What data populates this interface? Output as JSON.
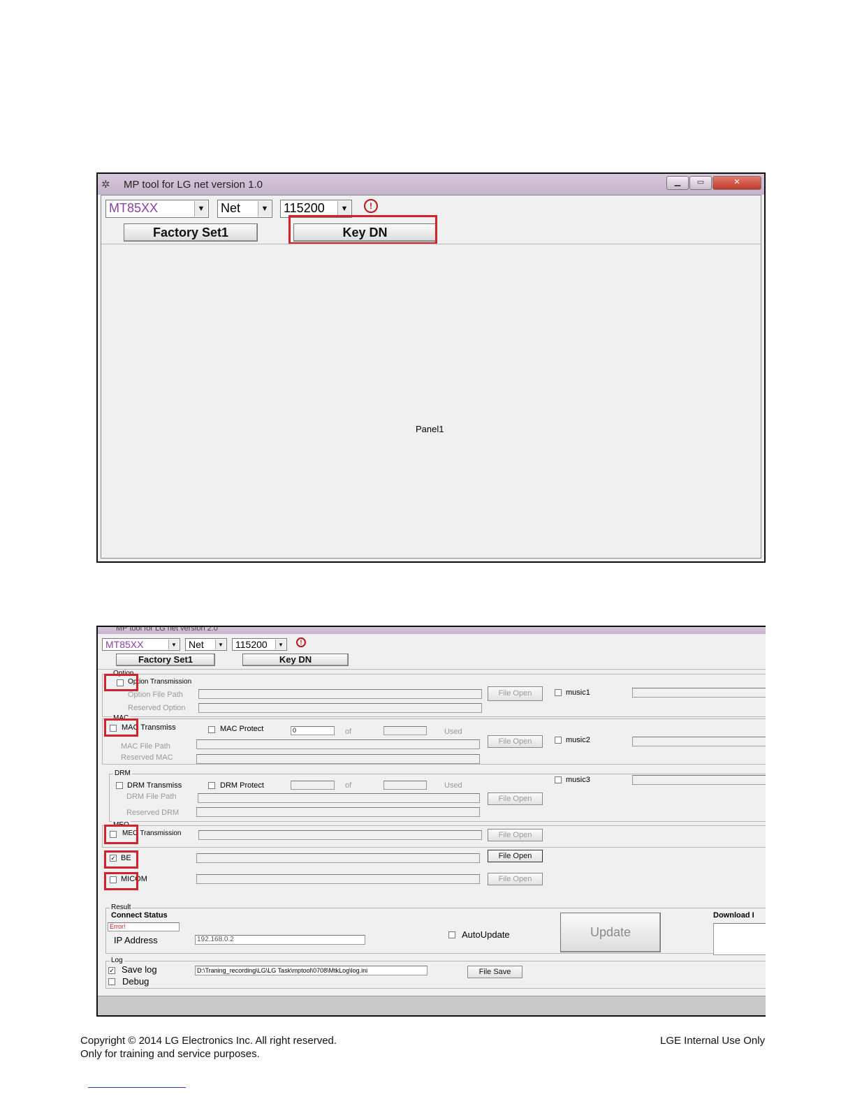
{
  "window1": {
    "title": "MP tool for LG net version 1.0",
    "chip_select": "MT85XX",
    "mode_select": "Net",
    "baud_select": "115200",
    "factory_set_label": "Factory Set1",
    "key_dn_label": "Key DN",
    "panel_label": "Panel1"
  },
  "window2": {
    "title": "MP tool for LG net version 2.0",
    "chip_select": "MT85XX",
    "mode_select": "Net",
    "baud_select": "115200",
    "factory_set_label": "Factory Set1",
    "key_dn_label": "Key DN",
    "option": {
      "group": "Option",
      "transmission_label": "Option Transmission",
      "file_path_label": "Option File Path",
      "reserved_label": "Reserved Option",
      "file_open": "File Open"
    },
    "mac": {
      "group": "MAC",
      "transmission_label": "MAC Transmiss",
      "protect_label": "MAC Protect",
      "count_value": "0",
      "of_label": "of",
      "used_label": "Used",
      "file_path_label": "MAC File Path",
      "reserved_label": "Reserved MAC",
      "file_open": "File Open"
    },
    "drm": {
      "group": "DRM",
      "transmission_label": "DRM Transmiss",
      "protect_label": "DRM Protect",
      "of_label": "of",
      "used_label": "Used",
      "file_path_label": "DRM File Path",
      "reserved_label": "Reserved DRM",
      "file_open": "File Open"
    },
    "music": [
      "music1",
      "music2",
      "music3"
    ],
    "meo": {
      "group": "MEO",
      "transmission_label": "MEO Transmission",
      "file_open": "File Open"
    },
    "be": {
      "label": "BE",
      "checked": true,
      "file_open": "File Open"
    },
    "micom": {
      "label": "MICOM",
      "file_open": "File Open"
    },
    "result": {
      "group": "Result",
      "connect_status_label": "Connect Status",
      "status_value": "Error!",
      "ip_label": "IP Address",
      "ip_value": "192.168.0.2",
      "auto_update_label": "AutoUpdate",
      "update_button": "Update",
      "download_label": "Download I"
    },
    "log": {
      "group": "Log",
      "save_log_label": "Save log",
      "save_log_checked": true,
      "debug_label": "Debug",
      "path_value": "D:\\Traning_recording\\LG\\LG Task\\mptool\\0708\\MtkLog\\log.ini",
      "file_save": "File Save"
    }
  },
  "footer": {
    "copyright_line1": "Copyright © 2014 LG Electronics Inc. All right reserved.",
    "copyright_line2": "Only for training and service purposes.",
    "internal": "LGE Internal Use Only"
  },
  "colors": {
    "highlight": "#d3222a",
    "title_bar": "#c5b2cb",
    "chip_text": "#8b3fa8",
    "error_text": "#c0141b"
  }
}
